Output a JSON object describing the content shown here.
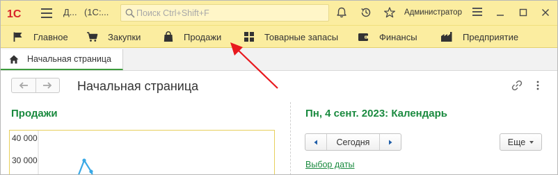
{
  "titlebar": {
    "logo_text": "1С",
    "title_short": "Д...",
    "title_app": "(1С:...",
    "search_placeholder": "Поиск Ctrl+Shift+F",
    "user_name": "Администратор"
  },
  "sections": {
    "items": [
      {
        "label": "Главное",
        "icon": "flag-icon"
      },
      {
        "label": "Закупки",
        "icon": "shopping-cart-icon"
      },
      {
        "label": "Продажи",
        "icon": "shopping-bag-icon"
      },
      {
        "label": "Товарные запасы",
        "icon": "grid-icon"
      },
      {
        "label": "Финансы",
        "icon": "wallet-icon"
      },
      {
        "label": "Предприятие",
        "icon": "factory-icon"
      }
    ]
  },
  "tabs": {
    "home_label": "Начальная страница"
  },
  "page": {
    "title": "Начальная страница"
  },
  "sales": {
    "title": "Продажи"
  },
  "chart_data": {
    "type": "line",
    "y_ticks": [
      "40 000",
      "30 000"
    ],
    "ylim": [
      20000,
      40000
    ],
    "series": [
      {
        "values": [
          30000,
          25000
        ]
      }
    ]
  },
  "calendar": {
    "title": "Пн, 4 сент. 2023: Календарь",
    "today_label": "Сегодня",
    "more_label": "Еще",
    "date_pick_label": "Выбор даты"
  },
  "colors": {
    "header_bg": "#fbeda0",
    "accent_green": "#1a8a3f",
    "logo_red": "#d8232a",
    "annotation_red": "#e8191e",
    "chart_line": "#3aa9e6"
  }
}
